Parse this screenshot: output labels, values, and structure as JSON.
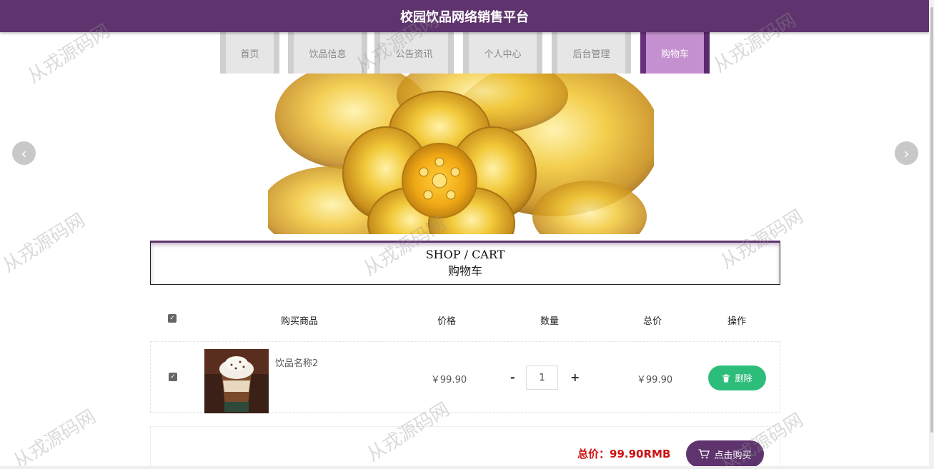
{
  "header": {
    "title": "校园饮品网络销售平台"
  },
  "nav": {
    "items": [
      {
        "label": "首页",
        "active": false
      },
      {
        "label": "饮品信息",
        "active": false
      },
      {
        "label": "公告资讯",
        "active": false
      },
      {
        "label": "个人中心",
        "active": false
      },
      {
        "label": "后台管理",
        "active": false
      },
      {
        "label": "购物车",
        "active": true
      }
    ]
  },
  "banner": {
    "prev_icon": "chevron-left-icon",
    "next_icon": "chevron-right-icon",
    "image": "gold-flower-ornament"
  },
  "cart": {
    "title_en": "SHOP / CART",
    "title_zh": "购物车",
    "columns": [
      "购买商品",
      "价格",
      "数量",
      "总价",
      "操作"
    ],
    "items": [
      {
        "checked": true,
        "name": "饮品名称2",
        "price": "￥99.90",
        "quantity": "1",
        "minus": "-",
        "plus": "+",
        "subtotal": "￥99.90",
        "delete_label": "删除",
        "delete_icon": "trash-icon"
      }
    ],
    "total_label": "总价：",
    "total_value": "99.90RMB",
    "buy_label": "点击购买",
    "buy_icon": "cart-icon"
  },
  "watermark": "从戎源码网",
  "colors": {
    "brand": "#5f346e",
    "nav_active": "#c490cf",
    "delete": "#2dbd7a",
    "total": "#cc1111"
  }
}
